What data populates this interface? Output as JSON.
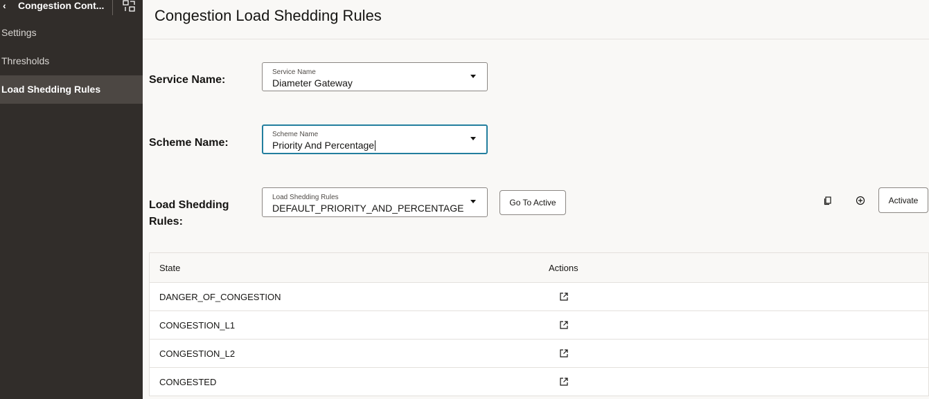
{
  "sidebar": {
    "title": "Congestion Cont...",
    "items": [
      {
        "label": "Settings"
      },
      {
        "label": "Thresholds"
      },
      {
        "label": "Load Shedding Rules"
      }
    ]
  },
  "page": {
    "title": "Congestion Load Shedding Rules"
  },
  "form": {
    "service": {
      "label": "Service Name:",
      "caption": "Service Name",
      "value": "Diameter Gateway"
    },
    "scheme": {
      "label": "Scheme Name:",
      "caption": "Scheme Name",
      "value": "Priority And Percentage"
    },
    "rules": {
      "label_line1": "Load Shedding",
      "label_line2": "Rules:",
      "caption": "Load Shedding Rules",
      "value": "DEFAULT_PRIORITY_AND_PERCENTAGE"
    }
  },
  "buttons": {
    "go_to_active": "Go To Active",
    "activate": "Activate"
  },
  "table": {
    "headers": [
      "State",
      "Actions"
    ],
    "rows": [
      {
        "state": "DANGER_OF_CONGESTION"
      },
      {
        "state": "CONGESTION_L1"
      },
      {
        "state": "CONGESTION_L2"
      },
      {
        "state": "CONGESTED"
      }
    ]
  },
  "icons": {
    "back": "chevron-left-icon",
    "expand": "expand-icon",
    "copy": "copy-icon",
    "add": "add-circle-icon",
    "open": "open-external-icon"
  },
  "colors": {
    "sidebar_bg": "#312d2a",
    "sidebar_active": "#4c4743",
    "focus_border": "#227e9e"
  }
}
